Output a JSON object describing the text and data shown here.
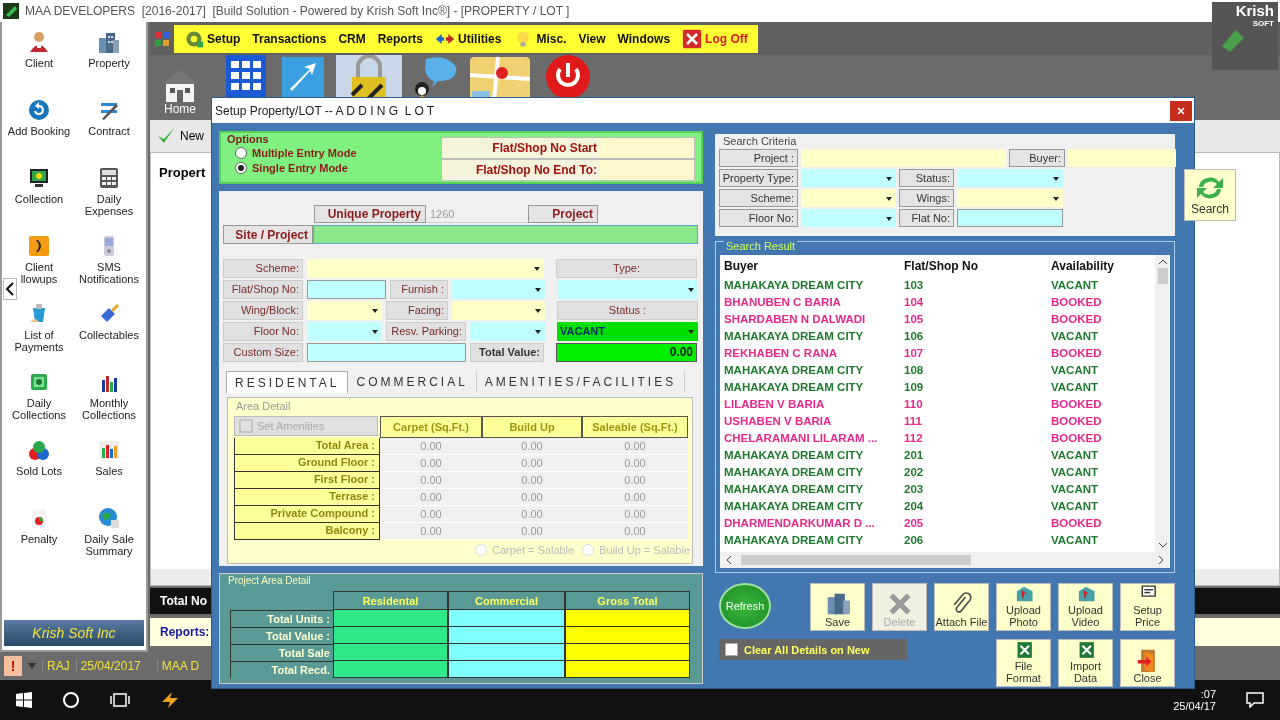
{
  "window": {
    "title": "MAA DEVELOPERS  [2016-2017]  [Build Solution - Powered by Krish Soft Inc®] - [PROPERTY / LOT ]"
  },
  "logo": {
    "name": "Krish",
    "sub": "SOFT"
  },
  "menu": [
    {
      "label": "Setup"
    },
    {
      "label": "Transactions"
    },
    {
      "label": "CRM"
    },
    {
      "label": "Reports"
    },
    {
      "label": "Utilities"
    },
    {
      "label": "Misc."
    },
    {
      "label": "View"
    },
    {
      "label": "Windows"
    },
    {
      "label": "Log Off"
    }
  ],
  "toolbar": {
    "home": "Home"
  },
  "sidebar": {
    "items": [
      {
        "label": "Client"
      },
      {
        "label": "Property"
      },
      {
        "label": "Add Booking"
      },
      {
        "label": "Contract"
      },
      {
        "label": "Collection"
      },
      {
        "label": "Daily Expenses"
      },
      {
        "label": "Client llowups"
      },
      {
        "label": "SMS Notifications"
      },
      {
        "label": "List of Payments"
      },
      {
        "label": "Collectables"
      },
      {
        "label": "Daily Collections"
      },
      {
        "label": "Monthly Collections"
      },
      {
        "label": "Sold Lots"
      },
      {
        "label": "Sales"
      },
      {
        "label": "Penalty"
      },
      {
        "label": "Daily Sale Summary"
      }
    ],
    "banner": "Krish Soft Inc"
  },
  "main": {
    "new_button": "New",
    "heading": "Propert",
    "totals_label": "Total No",
    "reports_label": "Reports:"
  },
  "status_bar": {
    "alert": "!",
    "user": "RAJ",
    "date": "25/04/2017",
    "company": "MAA D"
  },
  "taskbar": {
    "time": ":07",
    "date": "25/04/17"
  },
  "dialog": {
    "title": "Setup Property/LOT -- A D D I N G  L O T",
    "options": {
      "legend": "Options",
      "modes": [
        {
          "label": "Multiple Entry Mode",
          "selected": false
        },
        {
          "label": "Single Entry Mode",
          "selected": true
        }
      ],
      "range": [
        "Flat/Shop No Start",
        "Flat/Shop No End To:"
      ]
    },
    "unique_property": {
      "label": "Unique Property",
      "value": "1260"
    },
    "project_label": "Project",
    "site_project": "Site / Project",
    "form": {
      "scheme": "Scheme:",
      "type": "Type:",
      "flat_no": "Flat/Shop No:",
      "furnish": "Furnish :",
      "wing": "Wing/Block:",
      "facing": "Facing:",
      "status": {
        "label": "Status :",
        "value": "VACANT"
      },
      "floor": "Floor No:",
      "parking": "Resv. Parking:",
      "custom_size": "Custom Size:",
      "total_value": {
        "label": "Total Value:",
        "value": "0.00"
      }
    },
    "tabs": [
      {
        "label": "RESIDENTAL",
        "selected": true
      },
      {
        "label": "COMMERCIAL",
        "selected": false
      },
      {
        "label": "AMENITIES/FACILITIES",
        "selected": false
      }
    ],
    "area_detail": {
      "legend": "Area Detail",
      "set_amenities": {
        "label": "Set Amenities",
        "disabled": true
      },
      "columns": [
        "Carpet (Sq.Ft.)",
        "Build Up",
        "Saleable (Sq.Ft.)"
      ],
      "rows": [
        {
          "label": "Total Area :",
          "values": [
            "0.00",
            "0.00",
            "0.00"
          ]
        },
        {
          "label": "Ground Floor :",
          "values": [
            "0.00",
            "0.00",
            "0.00"
          ]
        },
        {
          "label": "First Floor :",
          "values": [
            "0.00",
            "0.00",
            "0.00"
          ]
        },
        {
          "label": "Terrase :",
          "values": [
            "0.00",
            "0.00",
            "0.00"
          ]
        },
        {
          "label": "Private Compound :",
          "values": [
            "0.00",
            "0.00",
            "0.00"
          ]
        },
        {
          "label": "Balcony :",
          "values": [
            "0.00",
            "0.00",
            "0.00"
          ]
        }
      ],
      "options": [
        {
          "label": "Carpet = Salable",
          "selected": false
        },
        {
          "label": "Build Up = Salable",
          "selected": false
        }
      ]
    },
    "project_area": {
      "legend": "Project Area Detail",
      "columns": [
        "Residental",
        "Commercial",
        "Gross Total"
      ],
      "rows": [
        "Total Units :",
        "Total Value :",
        "Total Sale",
        "Total Recd."
      ]
    },
    "search_criteria": {
      "legend": "Search Criteria",
      "project": "Project :",
      "buyer": "Buyer:",
      "property_type": "Property Type:",
      "status": "Status:",
      "scheme": "Scheme:",
      "wings": "Wings:",
      "floor_no": "Floor No:",
      "flat_no": "Flat No:",
      "search_button": "Search"
    },
    "search_result": {
      "legend": "Search Result",
      "columns": [
        "Buyer",
        "Flat/Shop No",
        "Availability"
      ],
      "rows": [
        {
          "buyer": "MAHAKAYA DREAM CITY",
          "flat": "103",
          "availability": "VACANT",
          "color": "#1e7b2e"
        },
        {
          "buyer": "BHANUBEN C BARIA",
          "flat": "104",
          "availability": "BOOKED",
          "color": "#e8288a"
        },
        {
          "buyer": "SHARDABEN N DALWADI",
          "flat": "105",
          "availability": "BOOKED",
          "color": "#e8288a"
        },
        {
          "buyer": "MAHAKAYA DREAM CITY",
          "flat": "106",
          "availability": "VACANT",
          "color": "#1e7b2e"
        },
        {
          "buyer": "REKHABEN C RANA",
          "flat": "107",
          "availability": "BOOKED",
          "color": "#e8288a"
        },
        {
          "buyer": "MAHAKAYA DREAM CITY",
          "flat": "108",
          "availability": "VACANT",
          "color": "#1e7b2e"
        },
        {
          "buyer": "MAHAKAYA DREAM CITY",
          "flat": "109",
          "availability": "VACANT",
          "color": "#1e7b2e"
        },
        {
          "buyer": "LILABEN V BARIA",
          "flat": "110",
          "availability": "BOOKED",
          "color": "#e8288a"
        },
        {
          "buyer": "USHABEN V BARIA",
          "flat": "111",
          "availability": "BOOKED",
          "color": "#e8288a"
        },
        {
          "buyer": "CHELARAMANI LILARAM ...",
          "flat": "112",
          "availability": "BOOKED",
          "color": "#e8288a"
        },
        {
          "buyer": "MAHAKAYA DREAM CITY",
          "flat": "201",
          "availability": "VACANT",
          "color": "#1e7b2e"
        },
        {
          "buyer": "MAHAKAYA DREAM CITY",
          "flat": "202",
          "availability": "VACANT",
          "color": "#1e7b2e"
        },
        {
          "buyer": "MAHAKAYA DREAM CITY",
          "flat": "203",
          "availability": "VACANT",
          "color": "#1e7b2e"
        },
        {
          "buyer": "MAHAKAYA DREAM CITY",
          "flat": "204",
          "availability": "VACANT",
          "color": "#1e7b2e"
        },
        {
          "buyer": "DHARMENDARKUMAR D  ...",
          "flat": "205",
          "availability": "BOOKED",
          "color": "#e8288a"
        },
        {
          "buyer": "MAHAKAYA DREAM CITY",
          "flat": "206",
          "availability": "VACANT",
          "color": "#1e7b2e"
        }
      ]
    },
    "actions": [
      {
        "label": "Refresh",
        "disabled": false
      },
      {
        "label": "Save",
        "disabled": false
      },
      {
        "label": "Delete",
        "disabled": true
      },
      {
        "label": "Attach File",
        "disabled": false
      },
      {
        "label": "Upload Photo",
        "disabled": false
      },
      {
        "label": "Upload Video",
        "disabled": false
      },
      {
        "label": "Setup Price",
        "disabled": false
      }
    ],
    "actions_row2": [
      {
        "label": "File Format"
      },
      {
        "label": "Import Data"
      },
      {
        "label": "Close"
      }
    ],
    "clear_on_new": {
      "label": "Clear All Details on New",
      "checked": false
    }
  }
}
